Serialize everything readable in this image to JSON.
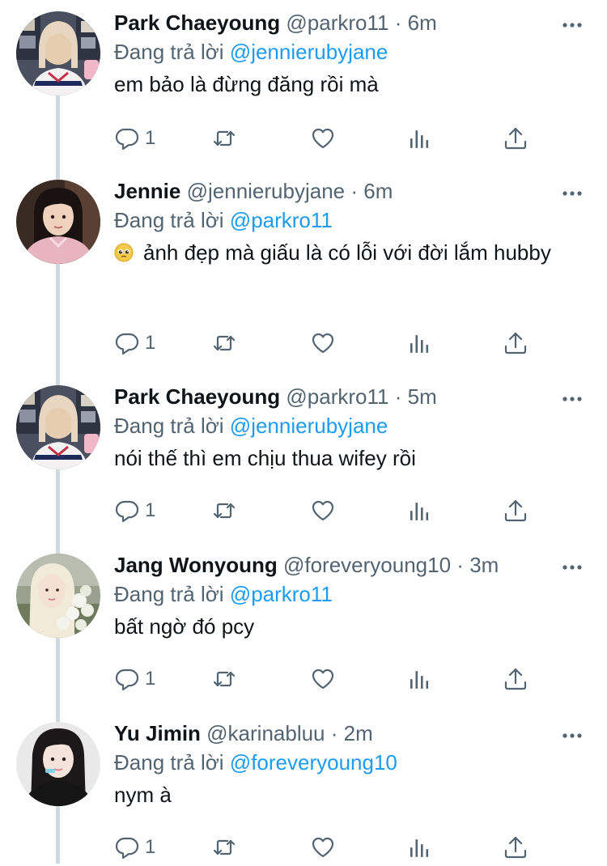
{
  "reply_prefix": "Đang trả lời",
  "colors": {
    "link": "#1d9bf0",
    "muted": "#536471",
    "text": "#0f1419",
    "thread_line": "#cfd9de"
  },
  "icons": {
    "reply": "reply-icon",
    "retweet": "retweet-icon",
    "like": "heart-icon",
    "views": "views-chart-icon",
    "share": "share-icon",
    "more": "more-dots-icon"
  },
  "tweets": [
    {
      "name": "Park Chaeyoung",
      "handle": "@parkro11",
      "time_sep": "·",
      "time": "6m",
      "replying_to": "@jennierubyjane",
      "text": "em bảo là đừng đăng rồi mà",
      "reply_count": "1"
    },
    {
      "name": "Jennie",
      "handle": "@jennierubyjane",
      "time_sep": "·",
      "time": "6m",
      "replying_to": "@parkro11",
      "emoji": "pleading-face",
      "text": "ảnh đẹp mà giấu là có lỗi với đời lắm hubby",
      "reply_count": "1"
    },
    {
      "name": "Park Chaeyoung",
      "handle": "@parkro11",
      "time_sep": "·",
      "time": "5m",
      "replying_to": "@jennierubyjane",
      "text": "nói thế thì em chịu thua wifey rồi",
      "reply_count": "1"
    },
    {
      "name": "Jang Wonyoung",
      "handle": "@foreveryoung10",
      "time_sep": "·",
      "time": "3m",
      "replying_to": "@parkro11",
      "text": "bất ngờ đó pcy",
      "reply_count": "1"
    },
    {
      "name": "Yu Jimin",
      "handle": "@karinabluu",
      "time_sep": "·",
      "time": "2m",
      "replying_to": "@foreveryoung10",
      "text": "nym à",
      "reply_count": "1"
    }
  ]
}
